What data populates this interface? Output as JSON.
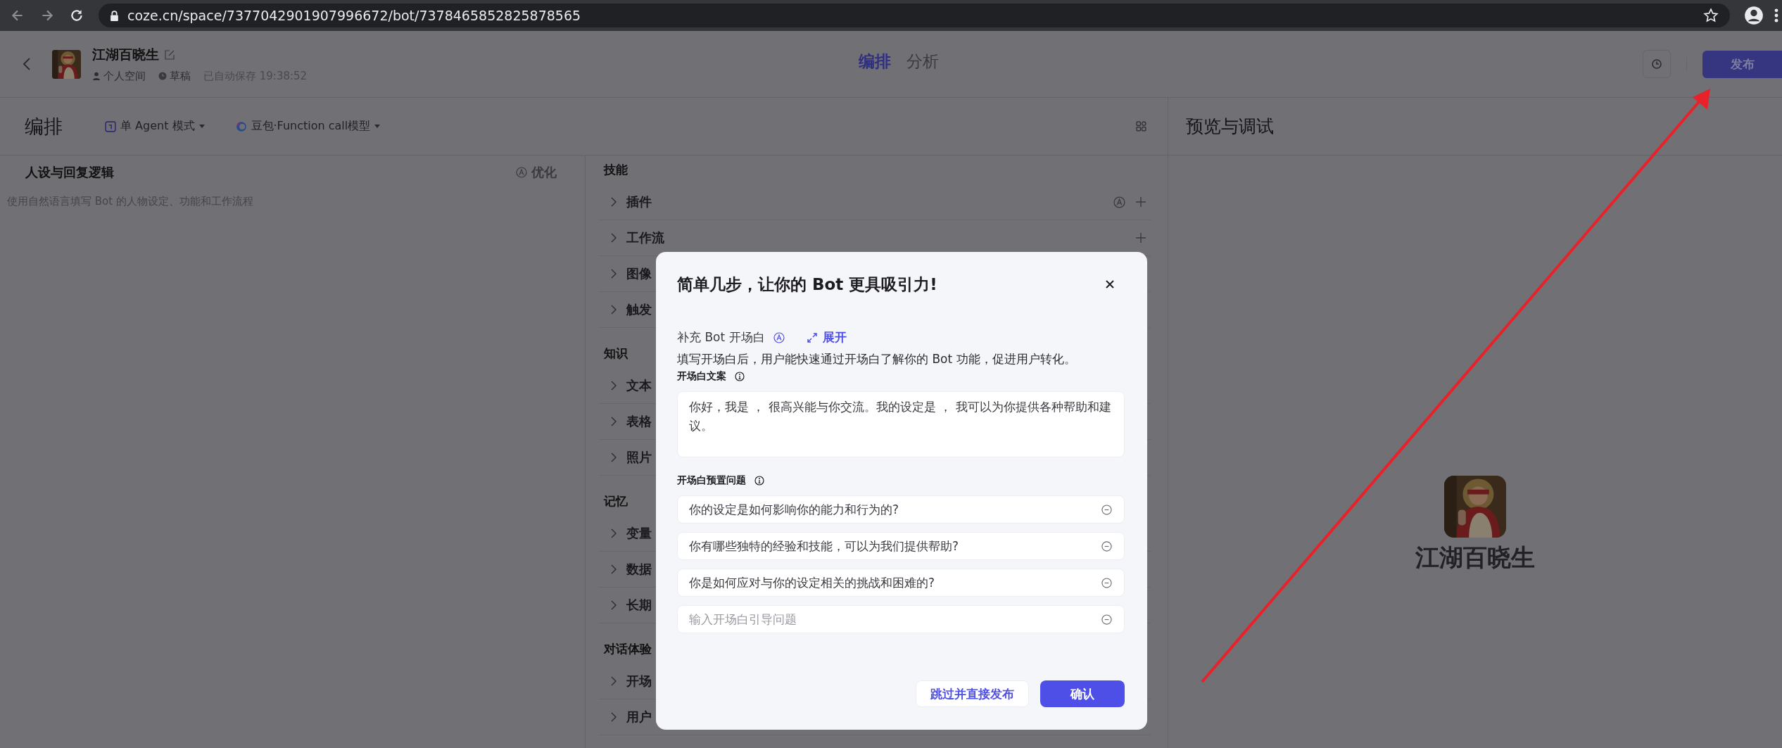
{
  "browser": {
    "url": "coze.cn/space/7377042901907996672/bot/7378465852825878565"
  },
  "header": {
    "bot_name": "江湖百晓生",
    "space": "个人空间",
    "status": "草稿",
    "autosave": "已自动保存 19:38:52",
    "tabs": [
      {
        "label": "编排",
        "selected": true
      },
      {
        "label": "分析",
        "selected": false
      }
    ],
    "publish_button": "发布"
  },
  "toolbar": {
    "title": "编排",
    "mode": "单 Agent 模式",
    "model": "豆包·Function call模型"
  },
  "persona": {
    "title": "人设与回复逻辑",
    "optimize": "优化",
    "placeholder": "使用自然语言填写 Bot 的人物设定、功能和工作流程"
  },
  "skills": [
    {
      "heading": "技能",
      "items": [
        {
          "label": "插件",
          "auto": true,
          "addable": true
        },
        {
          "label": "工作流",
          "addable": true
        },
        {
          "label": "图像"
        },
        {
          "label": "触发"
        }
      ]
    },
    {
      "heading": "知识",
      "items": [
        {
          "label": "文本"
        },
        {
          "label": "表格"
        },
        {
          "label": "照片"
        }
      ]
    },
    {
      "heading": "记忆",
      "items": [
        {
          "label": "变量"
        },
        {
          "label": "数据"
        },
        {
          "label": "长期"
        }
      ]
    },
    {
      "heading": "对话体验",
      "items": [
        {
          "label": "开场"
        },
        {
          "label": "用户"
        }
      ]
    }
  ],
  "preview": {
    "title": "预览与调试",
    "bot_name": "江湖百晓生"
  },
  "dialog": {
    "title": "简单几步，让你的 Bot 更具吸引力!",
    "section_label": "补充 Bot 开场白",
    "expand": "展开",
    "description": "填写开场白后，用户能快速通过开场白了解你的 Bot 功能，促进用户转化。",
    "greeting_label": "开场白文案",
    "greeting": "你好，我是 ， 很高兴能与你交流。我的设定是 ， 我可以为你提供各种帮助和建议。",
    "questions_label": "开场白预置问题",
    "questions": [
      "你的设定是如何影响你的能力和行为的?",
      "你有哪些独特的经验和技能，可以为我们提供帮助?",
      "你是如何应对与你的设定相关的挑战和困难的?"
    ],
    "question_placeholder": "输入开场白引导问题",
    "skip_button": "跳过并直接发布",
    "confirm_button": "确认"
  }
}
